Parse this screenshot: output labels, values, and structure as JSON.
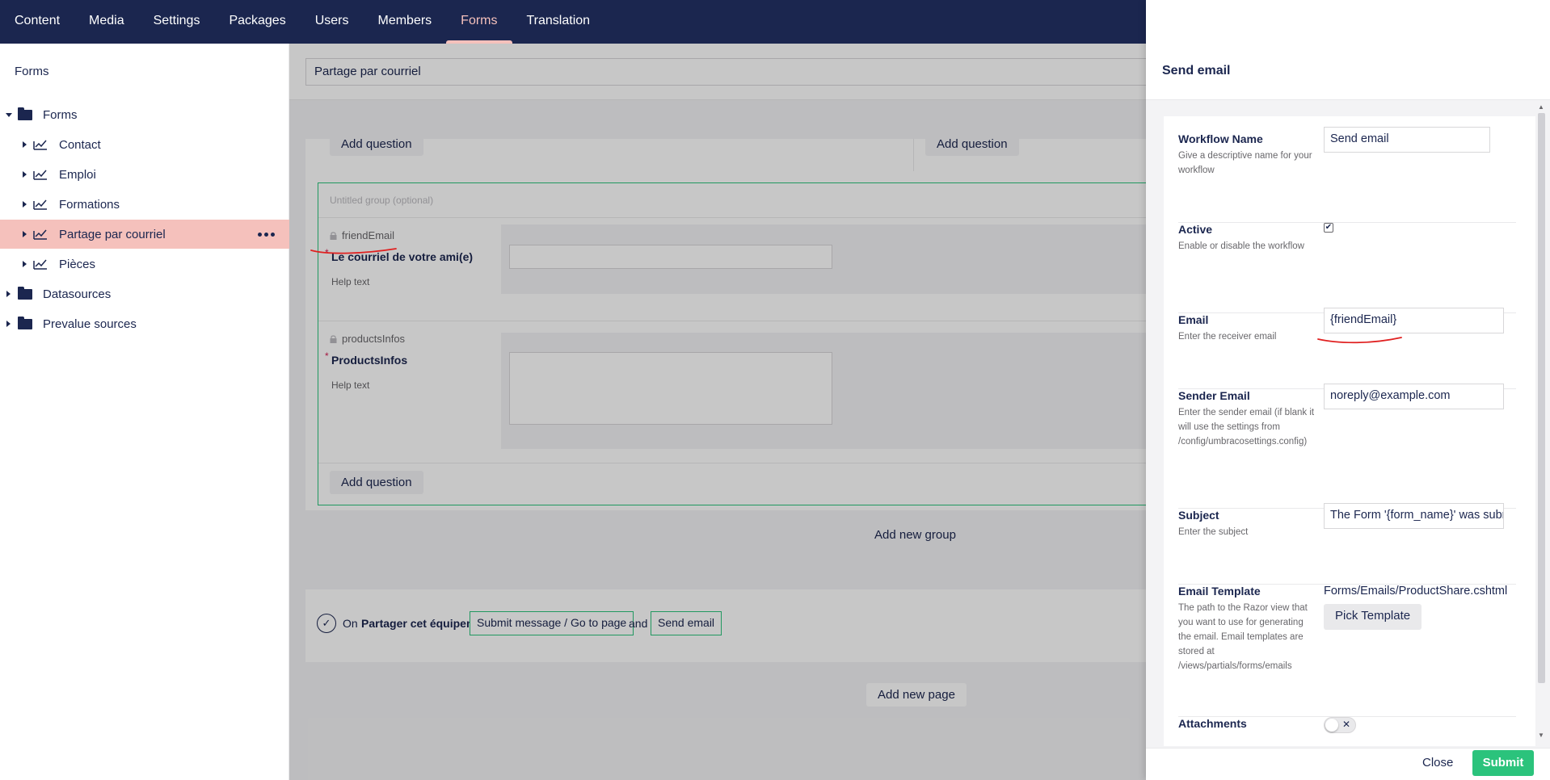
{
  "topnav": {
    "items": [
      "Content",
      "Media",
      "Settings",
      "Packages",
      "Users",
      "Members",
      "Forms",
      "Translation"
    ],
    "active_index": 6,
    "icons": [
      "search-icon",
      "help-icon",
      "user-avatar"
    ]
  },
  "sidebar": {
    "title": "Forms",
    "tree": [
      {
        "label": "Forms",
        "icon": "folder-icon",
        "expanded": true,
        "level": 0
      },
      {
        "label": "Contact",
        "icon": "form-icon",
        "level": 1
      },
      {
        "label": "Emploi",
        "icon": "form-icon",
        "level": 1
      },
      {
        "label": "Formations",
        "icon": "form-icon",
        "level": 1
      },
      {
        "label": "Partage par courriel",
        "icon": "form-icon",
        "level": 1,
        "selected": true
      },
      {
        "label": "Pièces",
        "icon": "form-icon",
        "level": 1
      },
      {
        "label": "Datasources",
        "icon": "folder-icon",
        "level": 0
      },
      {
        "label": "Prevalue sources",
        "icon": "folder-icon",
        "level": 0
      }
    ]
  },
  "editor": {
    "form_name": "Partage par courriel",
    "add_question_label": "Add question",
    "group_label": "Untitled group (optional)",
    "questions": [
      {
        "alias": "friendEmail",
        "label": "Le courriel de votre ami(e)",
        "help": "Help text"
      },
      {
        "alias": "productsInfos",
        "label": "ProductsInfos",
        "help": "Help text"
      }
    ],
    "add_new_group": "Add new group",
    "add_new_page": "Add new page",
    "workflow": {
      "on": "On",
      "trigger": "Partager cet équipement —",
      "step1": "Submit message / Go to page",
      "and": "and",
      "step2": "Send email"
    }
  },
  "dialog": {
    "title": "Send email",
    "fields": {
      "workflow_name": {
        "label": "Workflow Name",
        "desc": "Give a descriptive name for your workflow",
        "value": "Send email"
      },
      "active": {
        "label": "Active",
        "desc": "Enable or disable the workflow",
        "checked": true
      },
      "email": {
        "label": "Email",
        "desc": "Enter the receiver email",
        "value": "{friendEmail}"
      },
      "sender_email": {
        "label": "Sender Email",
        "desc": "Enter the sender email (if blank it will use the settings from /config/umbracosettings.config)",
        "value": "noreply@example.com"
      },
      "subject": {
        "label": "Subject",
        "desc": "Enter the subject",
        "value": "The Form '{form_name}' was submitted"
      },
      "email_template": {
        "label": "Email Template",
        "desc": "The path to the Razor view that you want to use for generating the email. Email templates are stored at /views/partials/forms/emails",
        "value": "Forms/Emails/ProductShare.cshtml",
        "button": "Pick Template"
      },
      "attachments": {
        "label": "Attachments",
        "enabled": false
      }
    },
    "close_label": "Close",
    "submit_label": "Submit"
  },
  "colors": {
    "header_bg": "#1b264f",
    "accent_pink": "#f5c1bc",
    "success_green": "#2bc37c",
    "annotation_red": "#e02020"
  }
}
